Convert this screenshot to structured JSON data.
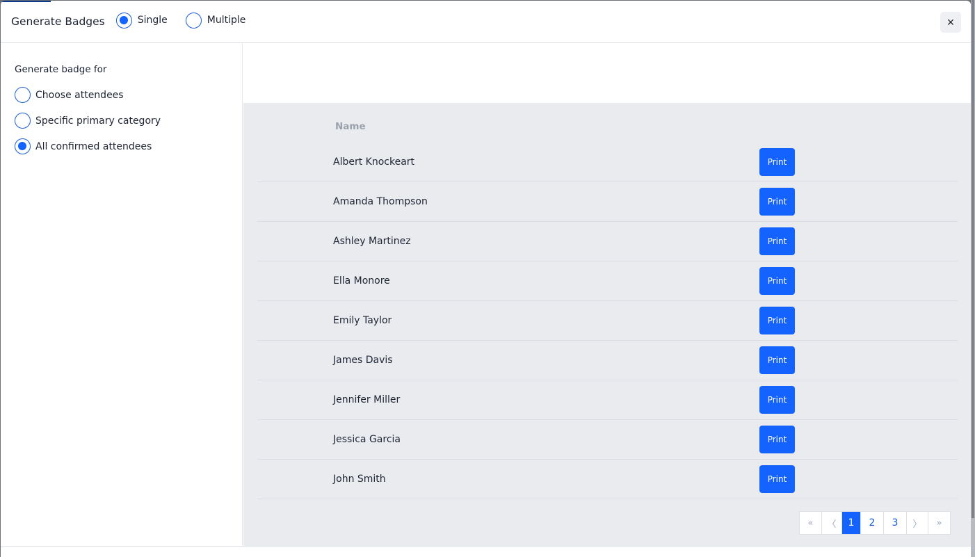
{
  "header": {
    "title": "Generate Badges",
    "mode_options": [
      {
        "label": "Single",
        "checked": true
      },
      {
        "label": "Multiple",
        "checked": false
      }
    ],
    "close_icon": "×"
  },
  "sidebar": {
    "heading": "Generate badge for",
    "options": [
      {
        "label": "Choose attendees",
        "checked": false
      },
      {
        "label": "Specific primary category",
        "checked": false
      },
      {
        "label": "All confirmed attendees",
        "checked": true
      }
    ]
  },
  "table": {
    "column_header": "Name",
    "print_label": "Print",
    "rows": [
      {
        "name": "Albert Knockeart"
      },
      {
        "name": "Amanda Thompson"
      },
      {
        "name": "Ashley Martinez"
      },
      {
        "name": "Ella Monore"
      },
      {
        "name": "Emily Taylor"
      },
      {
        "name": "James Davis"
      },
      {
        "name": "Jennifer Miller"
      },
      {
        "name": "Jessica Garcia"
      },
      {
        "name": "John Smith"
      }
    ]
  },
  "pagination": {
    "first": "«",
    "prev": "〈",
    "pages": [
      "1",
      "2",
      "3"
    ],
    "current_page": "1",
    "next": "〉",
    "last": "»"
  },
  "colors": {
    "accent": "#1463ff",
    "panel_bg": "#e9ebef"
  }
}
